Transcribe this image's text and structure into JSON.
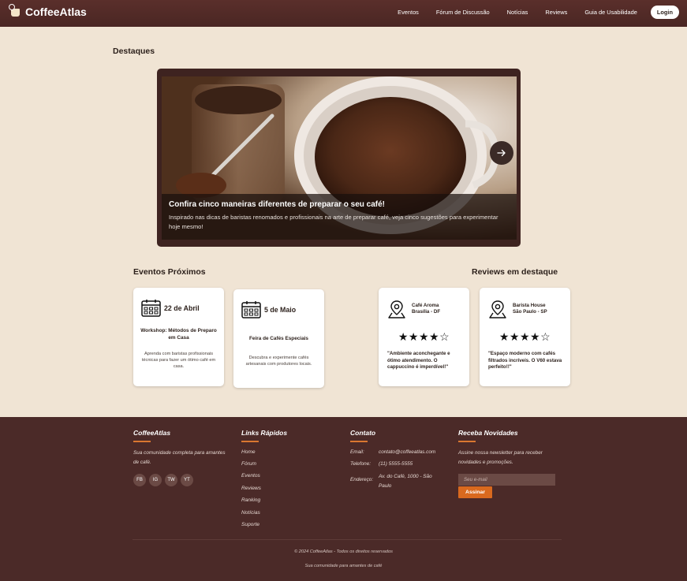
{
  "header": {
    "logo_text": "CoffeeAtlas",
    "nav": [
      "Eventos",
      "Fórum de Discussão",
      "Notícias",
      "Reviews",
      "Guia de Usabilidade"
    ],
    "login_label": "Login"
  },
  "highlights": {
    "title": "Destaques",
    "slide": {
      "title": "Confira cinco maneiras diferentes de preparar o seu café!",
      "text": "Inspirado nas dicas de baristas renomados e profissionais na arte de preparar café, veja cinco sugestões para experimentar hoje mesmo!"
    },
    "next_icon": "arrow-right-icon"
  },
  "events": {
    "title": "Eventos Próximos",
    "items": [
      {
        "date": "22 de Abril",
        "title": "Workshop: Métodos de Preparo em Casa",
        "desc": "Aprenda com baristas profissionais técnicas para fazer um ótimo café em casa."
      },
      {
        "date": "5 de Maio",
        "title": "Feira de Cafés Especiais",
        "desc": "Descubra e experimente cafés artesanais com produtores locais."
      }
    ]
  },
  "reviews": {
    "title": "Reviews em destaque",
    "items": [
      {
        "name": "Café Aroma",
        "location": "Brasília - DF",
        "rating": 4,
        "stars": "★★★★☆",
        "text": "\"Ambiente aconchegante e ótimo atendimento. O cappuccino é imperdível!\""
      },
      {
        "name": "Barista House",
        "location": "São Paulo - SP",
        "rating": 4,
        "stars": "★★★★☆",
        "text": "\"Espaço moderno com cafés filtrados incríveis. O V60 estava perfeito!!\""
      }
    ]
  },
  "footer": {
    "about": {
      "title": "CoffeeAtlas",
      "text": "Sua comunidade completa para amantes de café.",
      "social": [
        "FB",
        "IG",
        "TW",
        "YT"
      ]
    },
    "links": {
      "title": "Links Rápidos",
      "items": [
        "Home",
        "Fórum",
        "Eventos",
        "Reviews",
        "Ranking",
        "Notícias",
        "Suporte"
      ]
    },
    "contact": {
      "title": "Contato",
      "email_label": "Email:",
      "email": "contato@coffeeatlas.com",
      "phone_label": "Telefone:",
      "phone": "(11) 5555-5555",
      "address_label": "Endereço:",
      "address": "Av. do Café, 1000 - São Paulo"
    },
    "newsletter": {
      "title": "Receba Novidades",
      "text": "Assine nossa newsletter para receber novidades e promoções.",
      "placeholder": "Seu e-mail",
      "button": "Assinar"
    },
    "copyright": "© 2024 CoffeeAtlas - Todos os direitos reservados",
    "tagline": "Sua comunidade para amantes de café"
  },
  "colors": {
    "header_bg": "#4f2a27",
    "page_bg": "#f0e4d4",
    "footer_bg": "#4b2a28",
    "accent": "#d9691e"
  }
}
